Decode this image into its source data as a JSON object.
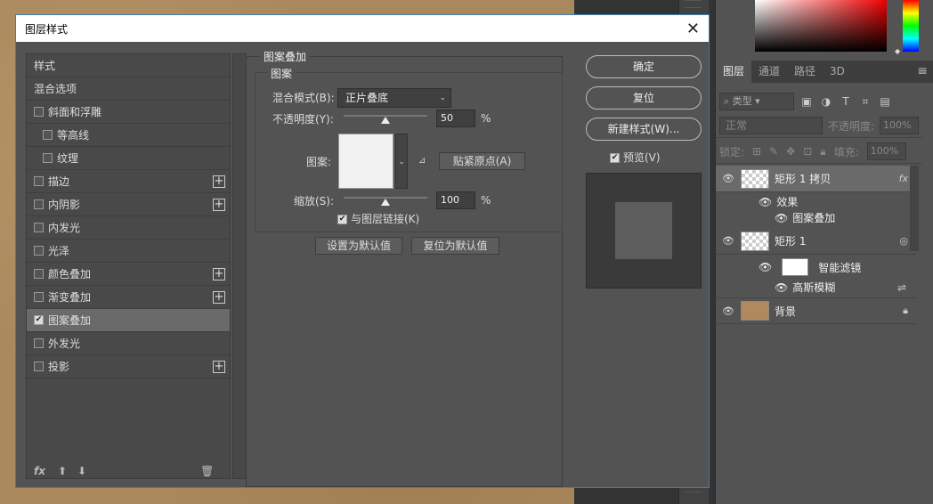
{
  "dialog": {
    "title": "图层样式",
    "close": "✕",
    "left_items": [
      {
        "label": "样式",
        "checkbox": false,
        "plus": false
      },
      {
        "label": "混合选项",
        "checkbox": false,
        "plus": false
      },
      {
        "label": "斜面和浮雕",
        "checkbox": true,
        "checked": false,
        "plus": false
      },
      {
        "label": "等高线",
        "checkbox": true,
        "checked": false,
        "plus": false,
        "indent": true
      },
      {
        "label": "纹理",
        "checkbox": true,
        "checked": false,
        "plus": false,
        "indent": true
      },
      {
        "label": "描边",
        "checkbox": true,
        "checked": false,
        "plus": true
      },
      {
        "label": "内阴影",
        "checkbox": true,
        "checked": false,
        "plus": true
      },
      {
        "label": "内发光",
        "checkbox": true,
        "checked": false,
        "plus": false
      },
      {
        "label": "光泽",
        "checkbox": true,
        "checked": false,
        "plus": false
      },
      {
        "label": "颜色叠加",
        "checkbox": true,
        "checked": false,
        "plus": true
      },
      {
        "label": "渐变叠加",
        "checkbox": true,
        "checked": false,
        "plus": true
      },
      {
        "label": "图案叠加",
        "checkbox": true,
        "checked": true,
        "plus": false,
        "selected": true
      },
      {
        "label": "外发光",
        "checkbox": true,
        "checked": false,
        "plus": false
      },
      {
        "label": "投影",
        "checkbox": true,
        "checked": false,
        "plus": true
      }
    ],
    "bottom_fx": "fx",
    "section_title": "图案叠加",
    "group_title": "图案",
    "blend_mode_label": "混合模式(B):",
    "blend_mode_value": "正片叠底",
    "opacity_label": "不透明度(Y):",
    "opacity_value": "50",
    "opacity_level": 0.5,
    "percent": "%",
    "pattern_label": "图案:",
    "snap_origin": "贴紧原点(A)",
    "scale_label": "缩放(S):",
    "scale_value": "100",
    "scale_level": 0.5,
    "link_label": "与图层链接(K)",
    "set_default": "设置为默认值",
    "reset_default": "复位为默认值",
    "ok": "确定",
    "reset": "复位",
    "new_style": "新建样式(W)...",
    "preview": "预览(V)"
  },
  "layers_panel": {
    "tabs": [
      "图层",
      "通道",
      "路径",
      "3D"
    ],
    "kind": "类型",
    "blend": "正常",
    "opacity_label": "不透明度:",
    "opacity_value": "100%",
    "lock_label": "锁定:",
    "fill_label": "填充:",
    "fill_value": "100%",
    "layers": [
      {
        "name": "矩形 1 拷贝",
        "right": "fx"
      },
      {
        "name": "效果"
      },
      {
        "name": "图案叠加"
      },
      {
        "name": "矩形 1"
      },
      {
        "name": "智能滤镜"
      },
      {
        "name": "高斯模糊"
      },
      {
        "name": "背景"
      }
    ]
  },
  "colors": {
    "accent": "#3c7fb1",
    "dialog_bg": "#535353",
    "selected_item": "#6a6a6a"
  }
}
